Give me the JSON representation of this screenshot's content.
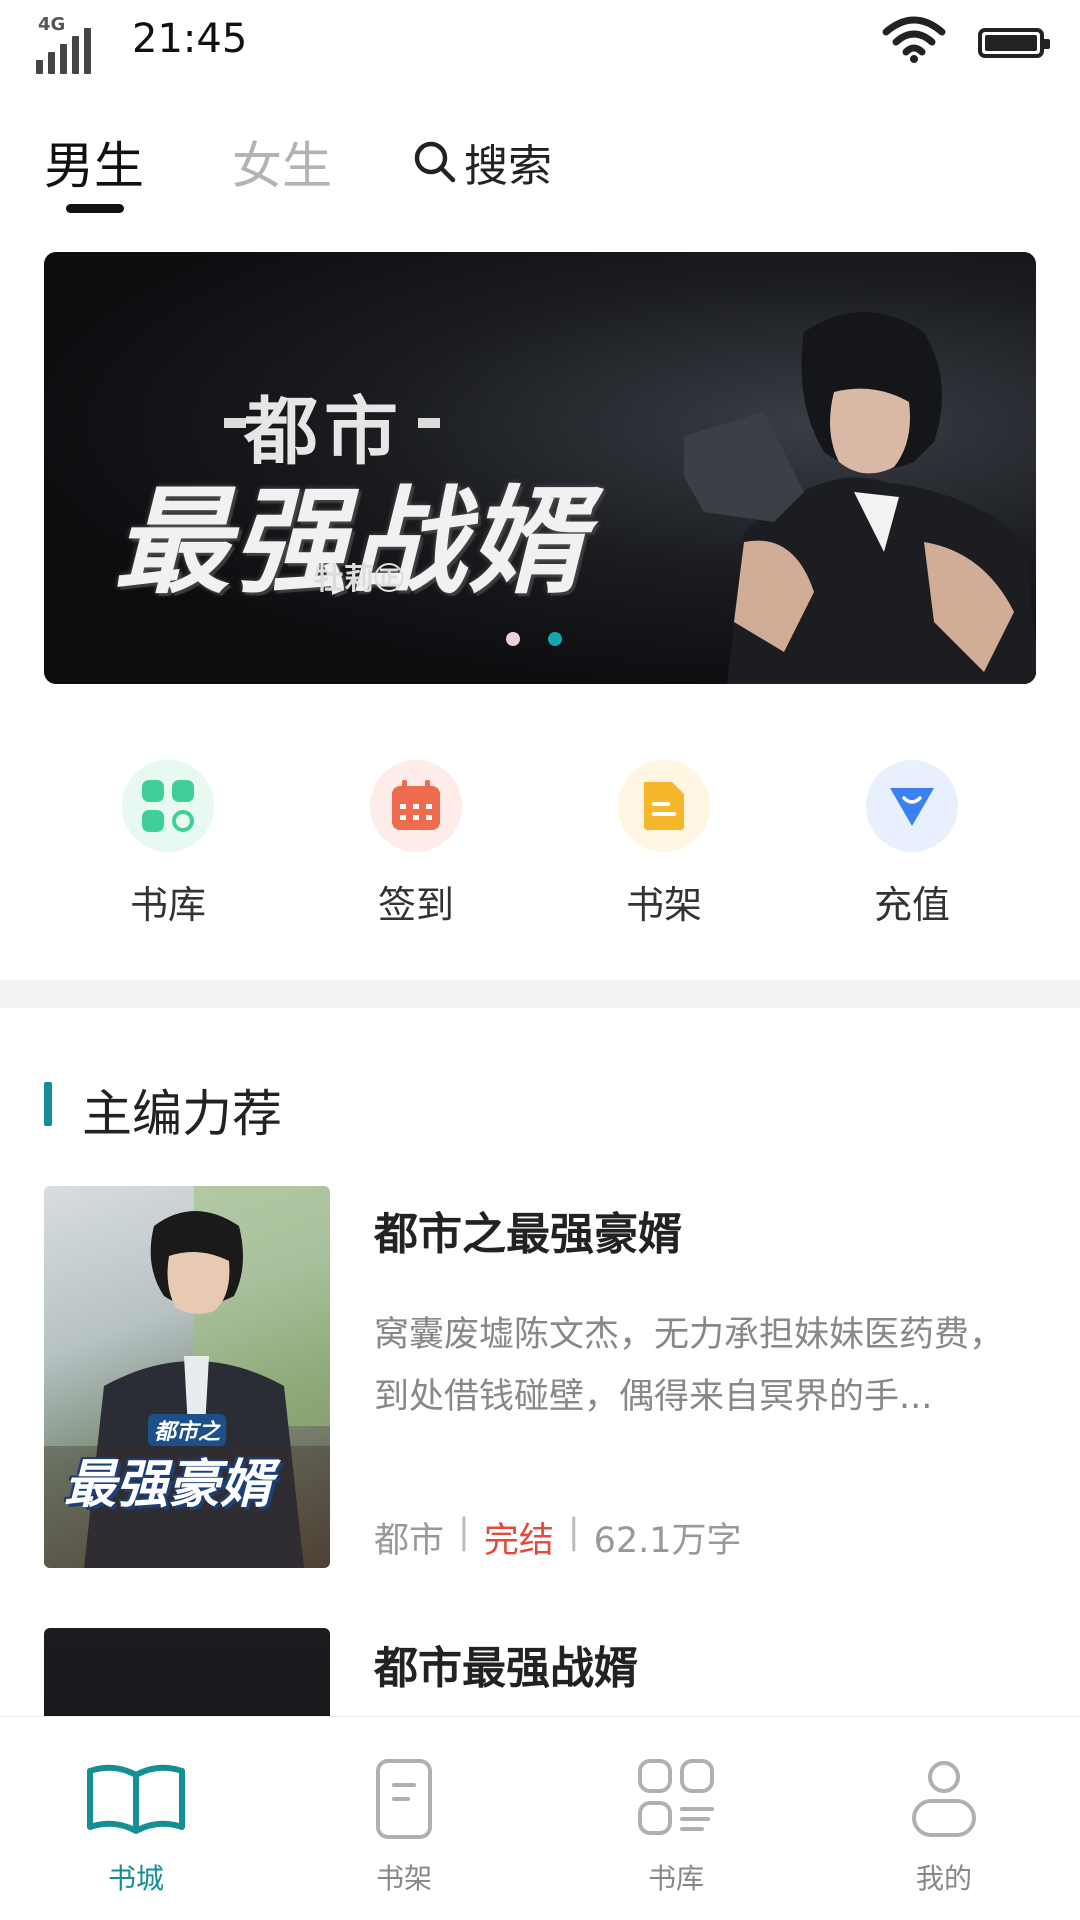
{
  "status_bar": {
    "network": "4G",
    "time": "21:45"
  },
  "header": {
    "tabs": [
      {
        "label": "男生"
      },
      {
        "label": "女生"
      }
    ],
    "search_label": "搜索"
  },
  "banner": {
    "subtitle": "都市",
    "title": "最强战婿",
    "author": "牡莉㊣",
    "dots": [
      {
        "color": "#f0d0d8"
      },
      {
        "color": "#13a8b0"
      }
    ]
  },
  "quick_entries": [
    {
      "label": "书库",
      "icon": "grid-icon",
      "color": "#3ecf9a",
      "bg": "#e8f9f2"
    },
    {
      "label": "签到",
      "icon": "calendar-icon",
      "color": "#ef6b4e",
      "bg": "#fdece8"
    },
    {
      "label": "书架",
      "icon": "document-icon",
      "color": "#f5b82a",
      "bg": "#fef6e0"
    },
    {
      "label": "充值",
      "icon": "diamond-icon",
      "color": "#3b82f0",
      "bg": "#e8f0fd"
    }
  ],
  "section": {
    "title": "主编力荐"
  },
  "books": [
    {
      "title": "都市之最强豪婿",
      "description": "窝囊废墟陈文杰，无力承担妹妹医药费，到处借钱碰壁，偶得来自冥界的手...",
      "genre": "都市",
      "status": "完结",
      "words": "62.1万字",
      "cover_text": "最强豪婿",
      "cover_sub": "都市之"
    },
    {
      "title": "都市最强战婿"
    }
  ],
  "bottom_nav": [
    {
      "label": "书城",
      "icon": "open-book-icon",
      "active": true
    },
    {
      "label": "书架",
      "icon": "notebook-icon",
      "active": false
    },
    {
      "label": "书库",
      "icon": "library-grid-icon",
      "active": false
    },
    {
      "label": "我的",
      "icon": "user-icon",
      "active": false
    }
  ],
  "colors": {
    "accent": "#158f93",
    "completed": "#e24b3b"
  }
}
